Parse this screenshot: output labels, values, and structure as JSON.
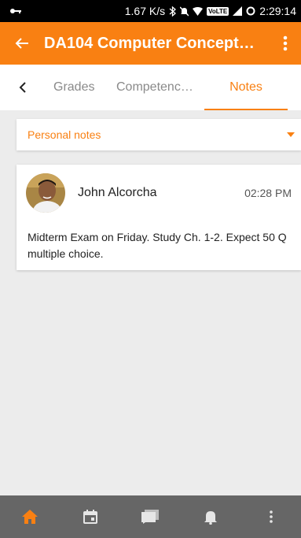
{
  "status_bar": {
    "speed": "1.67 K/s",
    "network_badge": "VoLTE",
    "time": "2:29:14"
  },
  "app_bar": {
    "title": "DA104 Computer Concept…",
    "icons": {
      "back": "arrow-left-icon",
      "more": "more-vert-icon"
    }
  },
  "tabs": {
    "items": [
      {
        "label": "Grades"
      },
      {
        "label": "Competenc…"
      },
      {
        "label": "Notes"
      }
    ],
    "selected": "Notes"
  },
  "filter": {
    "selected": "Personal notes"
  },
  "notes": [
    {
      "author": "John Alcorcha",
      "time": "02:28 PM",
      "text": "Midterm Exam on Friday. Study Ch. 1-2. Expect 50 Q multiple choice."
    }
  ],
  "bottom_nav": {
    "items": [
      "home-icon",
      "calendar-icon",
      "messages-icon",
      "notifications-icon",
      "more-vert-icon"
    ],
    "active": "home-icon"
  },
  "colors": {
    "accent": "#f98012",
    "status_bar": "#000000",
    "bottom_nav": "#666666",
    "background": "#ececec"
  }
}
